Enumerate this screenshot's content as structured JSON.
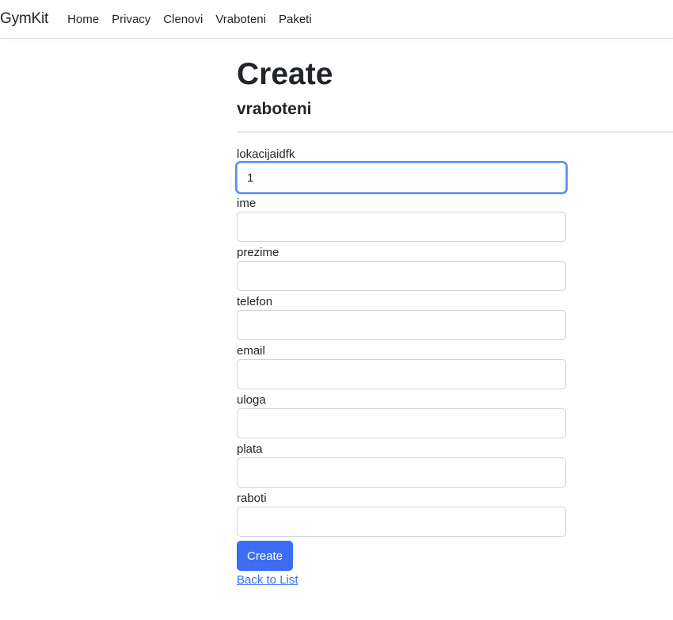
{
  "navbar": {
    "brand": "GymKit",
    "links": [
      "Home",
      "Privacy",
      "Clenovi",
      "Vraboteni",
      "Paketi"
    ]
  },
  "page": {
    "title": "Create",
    "subtitle": "vraboteni"
  },
  "form": {
    "fields": [
      {
        "label": "lokacijaidfk",
        "value": "1"
      },
      {
        "label": "ime",
        "value": ""
      },
      {
        "label": "prezime",
        "value": ""
      },
      {
        "label": "telefon",
        "value": ""
      },
      {
        "label": "email",
        "value": ""
      },
      {
        "label": "uloga",
        "value": ""
      },
      {
        "label": "plata",
        "value": ""
      },
      {
        "label": "raboti",
        "value": ""
      }
    ],
    "submit_label": "Create",
    "back_link": "Back to List"
  },
  "colors": {
    "primary": "#3b6ef5",
    "focus_ring": "#86b7fe"
  }
}
